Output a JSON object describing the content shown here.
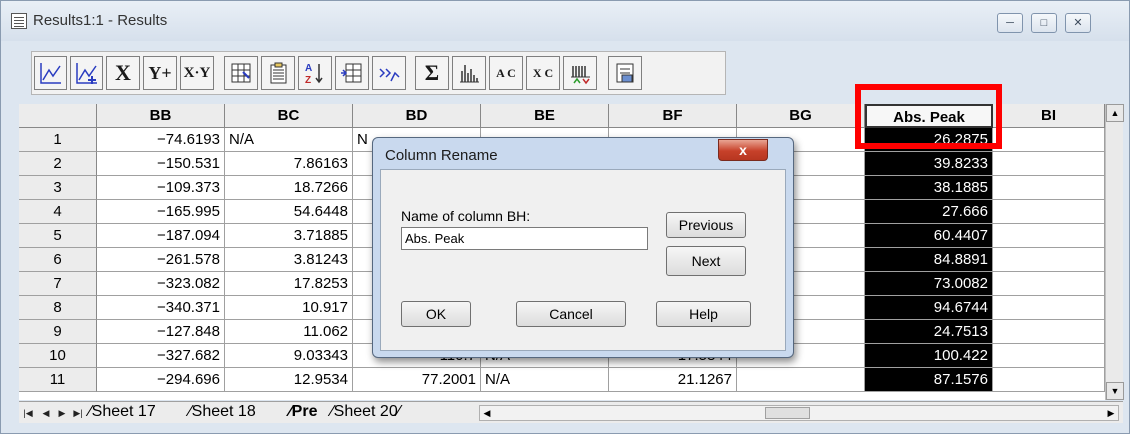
{
  "window": {
    "title": "Results1:1 - Results",
    "controls": [
      "minimize-icon",
      "restore-icon",
      "close-icon"
    ]
  },
  "toolbar": {
    "buttons": [
      "line-plot-icon",
      "line-plot-add-icon",
      "X",
      "Y+",
      "X·Y",
      "import-icon",
      "paste-icon",
      "sort-icon",
      "insert-column-icon",
      "transform-icon",
      "Σ",
      "histogram-icon",
      "A C",
      "X C",
      "peak-icon",
      "export-icon"
    ]
  },
  "table": {
    "columns": [
      "BB",
      "BC",
      "BD",
      "BE",
      "BF",
      "BG",
      "Abs. Peak",
      "BI"
    ],
    "rows": [
      {
        "n": "1",
        "bb": "-74.6193",
        "bc": "N/A",
        "bd": "N",
        "be": "",
        "bf": "",
        "bg": "",
        "peak": "26.2875"
      },
      {
        "n": "2",
        "bb": "-150.531",
        "bc": "7.86163",
        "bd": "",
        "be": "",
        "bf": "",
        "bg": "",
        "peak": "39.8233"
      },
      {
        "n": "3",
        "bb": "-109.373",
        "bc": "18.7266",
        "bd": "",
        "be": "",
        "bf": "",
        "bg": "",
        "peak": "38.1885"
      },
      {
        "n": "4",
        "bb": "-165.995",
        "bc": "54.6448",
        "bd": "",
        "be": "",
        "bf": "",
        "bg": "",
        "peak": "27.666"
      },
      {
        "n": "5",
        "bb": "-187.094",
        "bc": "3.71885",
        "bd": "",
        "be": "",
        "bf": "",
        "bg": "",
        "peak": "60.4407"
      },
      {
        "n": "6",
        "bb": "-261.578",
        "bc": "3.81243",
        "bd": "",
        "be": "",
        "bf": "",
        "bg": "",
        "peak": "84.8891"
      },
      {
        "n": "7",
        "bb": "-323.082",
        "bc": "17.8253",
        "bd": "",
        "be": "",
        "bf": "",
        "bg": "",
        "peak": "73.0082"
      },
      {
        "n": "8",
        "bb": "-340.371",
        "bc": "10.917",
        "bd": "",
        "be": "",
        "bf": "",
        "bg": "",
        "peak": "94.6744"
      },
      {
        "n": "9",
        "bb": "-127.848",
        "bc": "11.062",
        "bd": "",
        "be": "",
        "bf": "",
        "bg": "",
        "peak": "24.7513"
      },
      {
        "n": "10",
        "bb": "-327.682",
        "bc": "9.03343",
        "bd": "110.7",
        "be": "N/A",
        "bf": "17.5844",
        "bg": "",
        "peak": "100.422"
      },
      {
        "n": "11",
        "bb": "-294.696",
        "bc": "12.9534",
        "bd": "77.2001",
        "be": "N/A",
        "bf": "21.1267",
        "bg": "",
        "peak": "87.1576"
      }
    ]
  },
  "sheets": {
    "tabs": [
      "Sheet 17",
      "Sheet 18",
      "Pre",
      "Sheet 20"
    ],
    "active": "Pre"
  },
  "dialog": {
    "title": "Column Rename",
    "close_glyph": "x",
    "label": "Name of column BH:",
    "value": "Abs. Peak",
    "previous": "Previous",
    "next": "Next",
    "ok": "OK",
    "cancel": "Cancel",
    "help": "Help"
  },
  "colors": {
    "highlight": "#ff0000",
    "selected_column_bg": "#000000",
    "dialog_frame": "#c9d9ee"
  }
}
